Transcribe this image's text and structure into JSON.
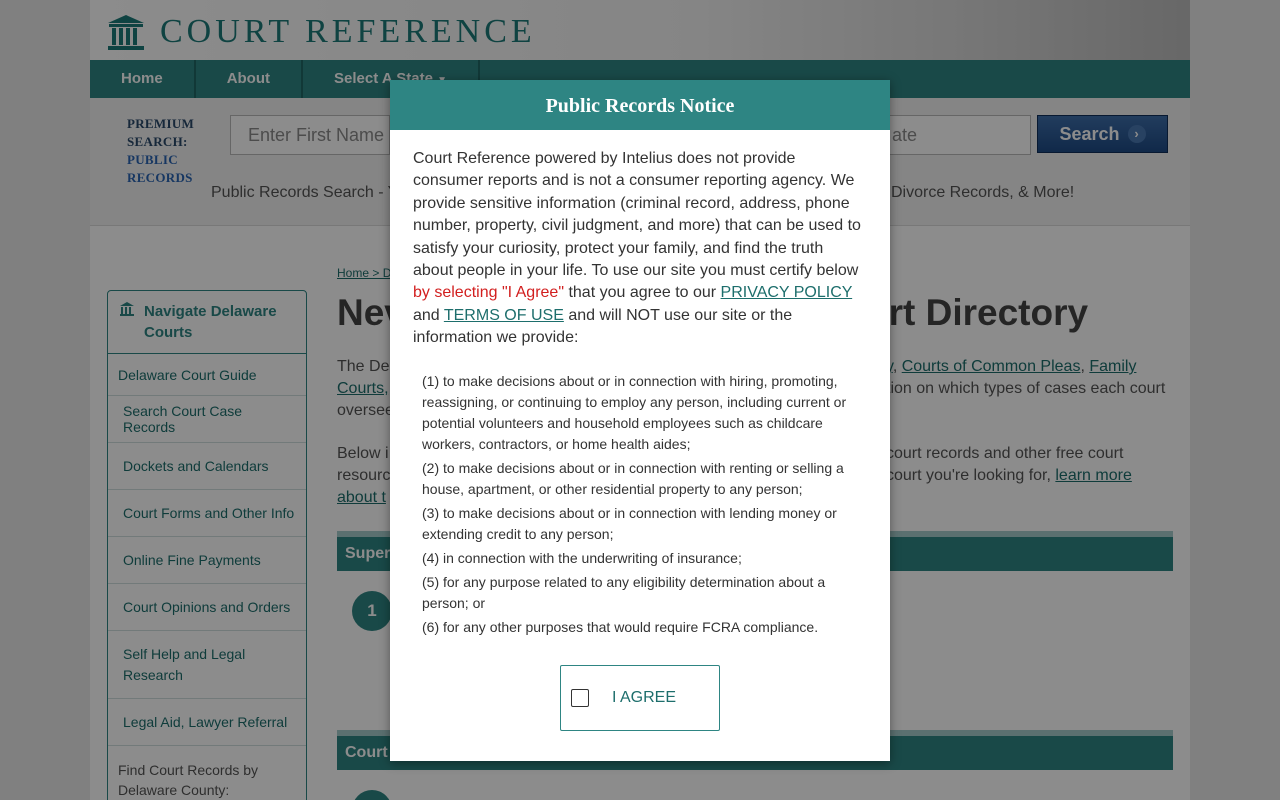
{
  "site": {
    "logo_text": "COURT REFERENCE"
  },
  "nav": [
    {
      "label": "Home"
    },
    {
      "label": "About"
    },
    {
      "label": "Select A State"
    }
  ],
  "search": {
    "premium_line1": "PREMIUM SEARCH:",
    "premium_line2": "PUBLIC RECORDS",
    "first_name_placeholder": "Enter First Name",
    "state_placeholder": "ate",
    "button_label": "Search",
    "tagline_left": "Public Records Search - Y",
    "tagline_right": "Divorce Records, & More!"
  },
  "sidebar": {
    "heading": "Navigate Delaware Courts",
    "items": [
      {
        "label": "Delaware Court Guide"
      },
      {
        "label": "Search Court Case Records"
      },
      {
        "label": "Dockets and Calendars"
      },
      {
        "label": "Court Forms and Other Info"
      },
      {
        "label": "Online Fine Payments"
      },
      {
        "label": "Court Opinions and Orders"
      },
      {
        "label": "Self Help and Legal Research"
      },
      {
        "label": "Legal Aid, Lawyer Referral"
      }
    ],
    "find_label": "Find Court Records by Delaware County:"
  },
  "main": {
    "breadcrumb_home": "Home",
    "breadcrumb_sep": " > D",
    "title_left": "Nev",
    "title_right": "urt Directory",
    "para1_left1": "The Del",
    "para1_left2": "Courts,",
    "para1_left3": "oversee",
    "para1_right_link1": "y",
    "para1_right_link2": "Courts of Common Pleas",
    "para1_right_link3": "Family",
    "para1_right_line2": "tion on which types of cases each court",
    "para2_left1": "Below i",
    "para2_left2": "resourc",
    "para2_left3": "about t",
    "para2_right1": "court records and other free court",
    "para2_right2": "court you're looking for,",
    "para2_right_link": "learn more",
    "section1": "Super",
    "section1_num": "1",
    "section2": "Court"
  },
  "modal": {
    "title": "Public Records Notice",
    "notice_part1": "Court Reference powered by Intelius does not provide consumer reports and is not a consumer reporting agency. We provide sensitive information (criminal record, address, phone number, property, civil judgment, and more) that can be used to satisfy your curiosity, protect your family, and find the truth about people in your life. To use our site you must certify below ",
    "notice_red": "by selecting \"I Agree\"",
    "notice_part2": " that you agree to our ",
    "privacy_link": "PRIVACY POLICY",
    "notice_part3": " and ",
    "terms_link": "TERMS OF USE",
    "notice_part4": " and will NOT use our site or the information we provide:",
    "purposes": [
      "(1) to make decisions about or in connection with hiring, promoting, reassigning, or continuing to employ any person, including current or potential volunteers and household employees such as childcare workers, contractors, or home health aides;",
      "(2) to make decisions about or in connection with renting or selling a house, apartment, or other residential property to any person;",
      "(3) to make decisions about or in connection with lending money or extending credit to any person;",
      "(4) in connection with the underwriting of insurance;",
      "(5) for any purpose related to any eligibility determination about a person; or",
      "(6) for any other purposes that would require FCRA compliance."
    ],
    "agree_label": "I AGREE"
  },
  "colors": {
    "teal": "#2e8583",
    "link_teal": "#1d6e6c",
    "red": "#d21f1f",
    "search_blue": "#1e4b85"
  }
}
